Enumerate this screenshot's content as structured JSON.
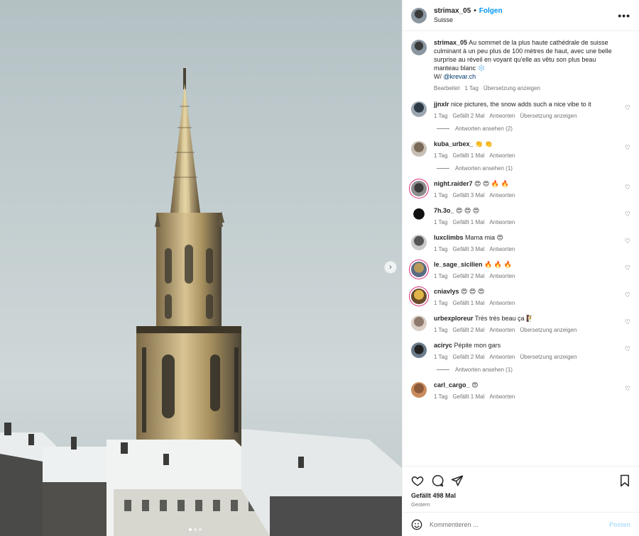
{
  "header": {
    "username": "strimax_05",
    "separator": "•",
    "follow_label": "Folgen",
    "location": "Suisse",
    "more_label": "•••"
  },
  "caption": {
    "username": "strimax_05",
    "text": "Au sommet de la plus haute cathédrale de suisse culminant à un peu plus de 100 mètres de haut, avec une belle surprise au réveil en voyant qu'elle as vêtu son plus beau manteau blanc ❄️",
    "credit_prefix": "W/ ",
    "credit_link": "@krevar.ch",
    "meta": {
      "edited": "Bearbeitet",
      "time": "1 Tag",
      "translate": "Übersetzung anzeigen"
    }
  },
  "comments": [
    {
      "user": "jjnxlr",
      "text": "nice pictures, the snow adds such a nice vibe to it",
      "time": "1 Tag",
      "likes": "Gefällt 2 Mal",
      "reply": "Antworten",
      "translate": "Übersetzung anzeigen",
      "view_replies": "Antworten ansehen (2)"
    },
    {
      "user": "kuba_urbex_",
      "text": "👏 👏",
      "time": "1 Tag",
      "likes": "Gefällt 1 Mal",
      "reply": "Antworten",
      "translate": "",
      "view_replies": "Antworten ansehen (1)"
    },
    {
      "user": "night.raider7",
      "text": "😍 😍 🔥 🔥",
      "time": "1 Tag",
      "likes": "Gefällt 3 Mal",
      "reply": "Antworten",
      "translate": "",
      "view_replies": ""
    },
    {
      "user": "7h.3o_",
      "text": "😍 😍 😍",
      "time": "1 Tag",
      "likes": "Gefällt 1 Mal",
      "reply": "Antworten",
      "translate": "",
      "view_replies": ""
    },
    {
      "user": "luxclimbs",
      "text": "Mama mia 😍",
      "time": "1 Tag",
      "likes": "Gefällt 3 Mal",
      "reply": "Antworten",
      "translate": "",
      "view_replies": ""
    },
    {
      "user": "le_sage_sicilien",
      "text": "🔥 🔥 🔥",
      "time": "1 Tag",
      "likes": "Gefällt 2 Mal",
      "reply": "Antworten",
      "translate": "",
      "view_replies": ""
    },
    {
      "user": "cniavlys",
      "text": "😍 😍 😍",
      "time": "1 Tag",
      "likes": "Gefällt 1 Mal",
      "reply": "Antworten",
      "translate": "",
      "view_replies": ""
    },
    {
      "user": "urbexploreur",
      "text": "Très très beau ça 🧗",
      "time": "1 Tag",
      "likes": "Gefällt 2 Mal",
      "reply": "Antworten",
      "translate": "Übersetzung anzeigen",
      "view_replies": ""
    },
    {
      "user": "aciryc",
      "text": "Pépite mon gars",
      "time": "1 Tag",
      "likes": "Gefällt 2 Mal",
      "reply": "Antworten",
      "translate": "Übersetzung anzeigen",
      "view_replies": "Antworten ansehen (1)"
    },
    {
      "user": "carl_cargo_",
      "text": "😍",
      "time": "1 Tag",
      "likes": "Gefällt 1 Mal",
      "reply": "Antworten",
      "translate": "",
      "view_replies": ""
    }
  ],
  "footer": {
    "likes": "Gefällt 498 Mal",
    "date": "Gestern",
    "comment_placeholder": "Kommentieren ...",
    "post_label": "Posten"
  },
  "icons": {
    "like": "heart-icon",
    "comment": "comment-icon",
    "share": "share-icon",
    "save": "bookmark-icon",
    "emoji": "emoji-icon",
    "next": "chevron-right-icon",
    "more": "more-icon"
  },
  "colors": {
    "accent": "#0095f6",
    "link": "#00376b",
    "muted": "#737373",
    "story_ring": "#d62976"
  },
  "carousel": {
    "slides": 3,
    "active": 1
  }
}
